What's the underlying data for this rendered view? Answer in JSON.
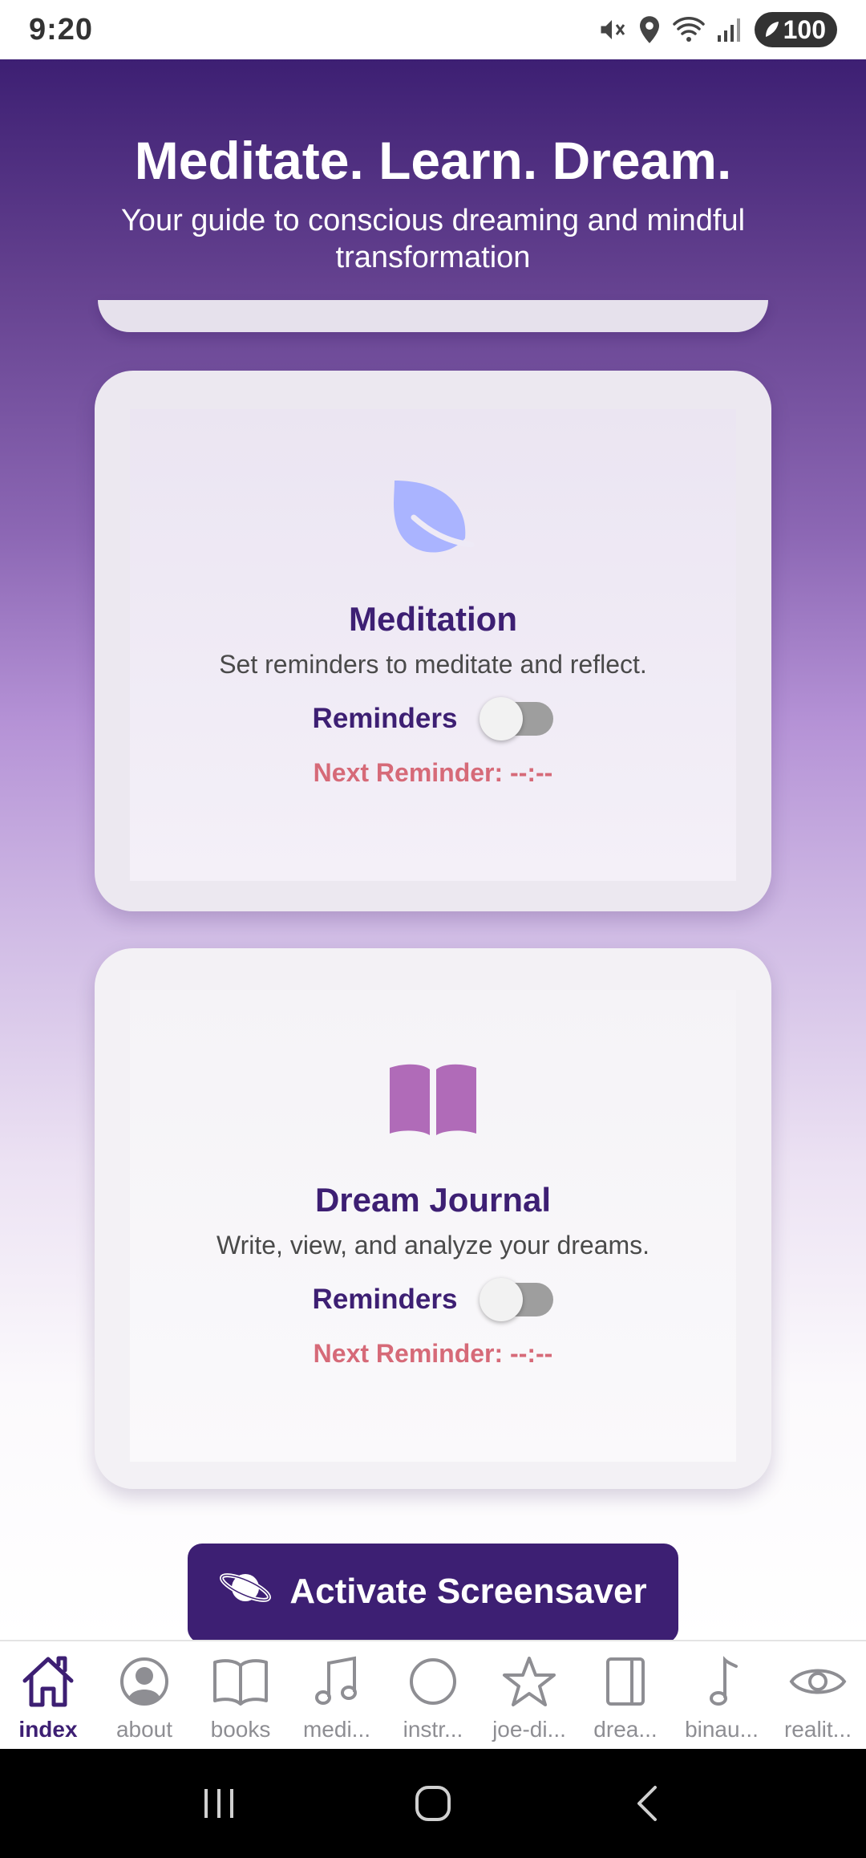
{
  "status_bar": {
    "time": "9:20",
    "battery": "100",
    "icons": [
      "mute-icon",
      "location-icon",
      "wifi-icon",
      "signal-icon",
      "battery-icon"
    ]
  },
  "hero": {
    "title": "Meditate. Learn. Dream.",
    "subtitle": "Your guide to conscious dreaming and mindful transformation"
  },
  "cards": [
    {
      "icon": "leaf-icon",
      "title": "Meditation",
      "description": "Set reminders to meditate and reflect.",
      "reminders_label": "Reminders",
      "reminders_enabled": false,
      "next_reminder": "Next Reminder: --:--"
    },
    {
      "icon": "book-icon",
      "title": "Dream Journal",
      "description": "Write, view, and analyze your dreams.",
      "reminders_label": "Reminders",
      "reminders_enabled": false,
      "next_reminder": "Next Reminder: --:--"
    }
  ],
  "screensaver_button": {
    "label": "Activate Screensaver",
    "icon": "planet-icon"
  },
  "tabs": [
    {
      "label": "index",
      "icon": "home-icon",
      "active": true
    },
    {
      "label": "about",
      "icon": "user-circle-icon",
      "active": false
    },
    {
      "label": "books",
      "icon": "open-book-icon",
      "active": false
    },
    {
      "label": "medi...",
      "icon": "music-note-icon",
      "active": false
    },
    {
      "label": "instr...",
      "icon": "circle-icon",
      "active": false
    },
    {
      "label": "joe-di...",
      "icon": "star-icon",
      "active": false
    },
    {
      "label": "drea...",
      "icon": "journal-icon",
      "active": false
    },
    {
      "label": "binau...",
      "icon": "single-note-icon",
      "active": false
    },
    {
      "label": "realit...",
      "icon": "eye-icon",
      "active": false
    }
  ],
  "colors": {
    "brand": "#3d1f73",
    "accent_red": "#d66a78",
    "leaf": "#aab4ff",
    "book": "#b06bb8"
  }
}
